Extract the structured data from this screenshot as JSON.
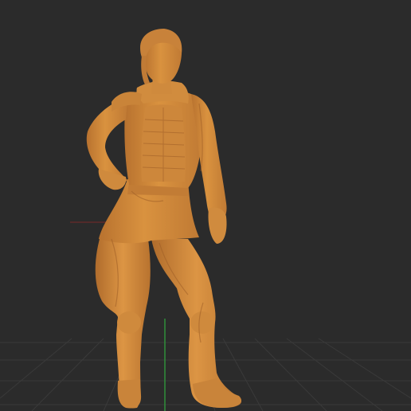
{
  "viewport": {
    "background_color": "#2b2b2b",
    "grid_color": "#3a3a3a",
    "axis_x_color": "#8c2a2a",
    "axis_y_color": "#2f8f3a",
    "model_color": "#d8913f",
    "model_shadow_color": "#a8652a",
    "model_highlight_color": "#e9a85a",
    "model_name": "sculpted-figure"
  }
}
